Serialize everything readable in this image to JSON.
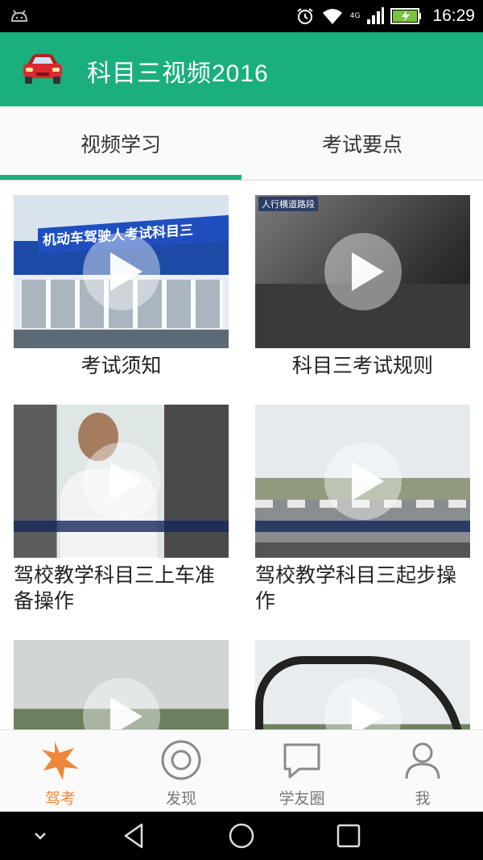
{
  "status_bar": {
    "time": "16:29",
    "network": "4G",
    "icons": [
      "android-debug-icon",
      "alarm-icon",
      "wifi-icon",
      "signal-icon",
      "battery-charging-icon"
    ]
  },
  "app_bar": {
    "title": "科目三视频2016",
    "logo_icon": "red-car-icon",
    "color": "#1aaf7d"
  },
  "tabs": [
    {
      "label": "视频学习",
      "selected": true
    },
    {
      "label": "考试要点",
      "selected": false
    }
  ],
  "videos": [
    {
      "title": "考试须知",
      "thumb_text": "机动车驾驶人考试科目三"
    },
    {
      "title": "科目三考试规则",
      "thumb_text": "人行横道路段"
    },
    {
      "title": "驾校教学科目三上车准备操作",
      "thumb_text": ""
    },
    {
      "title": "驾校教学科目三起步操作",
      "thumb_text": ""
    },
    {
      "title": "",
      "thumb_text": ""
    },
    {
      "title": "",
      "thumb_text": ""
    }
  ],
  "bottom_nav": [
    {
      "label": "驾考",
      "icon": "star-burst-icon",
      "active": true
    },
    {
      "label": "发现",
      "icon": "target-icon",
      "active": false
    },
    {
      "label": "学友圈",
      "icon": "chat-bubble-icon",
      "active": false
    },
    {
      "label": "我",
      "icon": "person-icon",
      "active": false
    }
  ],
  "colors": {
    "primary": "#1aaf7d",
    "active_nav": "#f0863a",
    "inactive_nav": "#8a8a8a"
  }
}
